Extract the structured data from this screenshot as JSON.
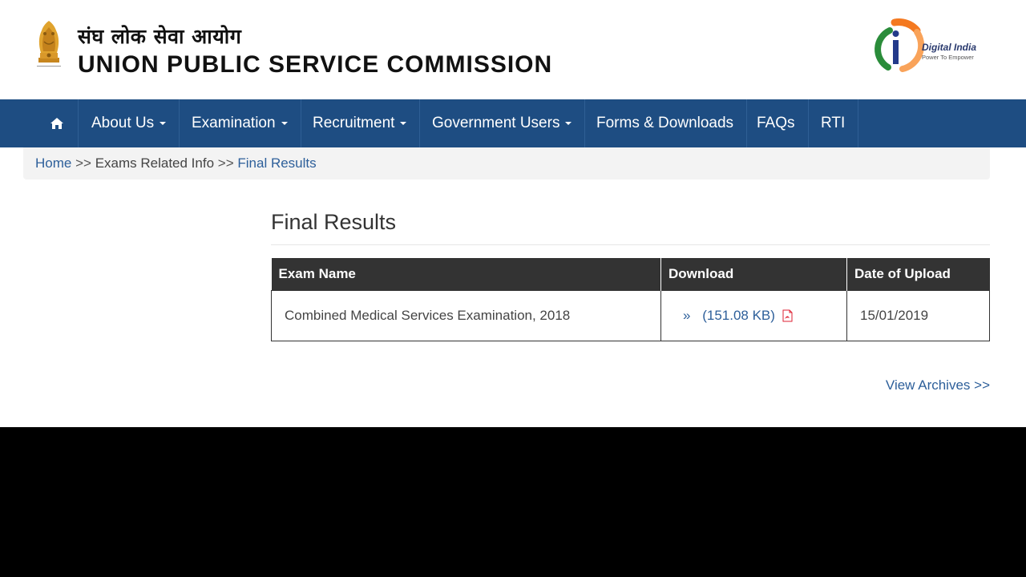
{
  "header": {
    "hindi_title": "संघ लोक सेवा आयोग",
    "english_title": "UNION PUBLIC SERVICE COMMISSION",
    "emblem_motto": "सत्यमेव जयते",
    "digital_india_title": "Digital India",
    "digital_india_tagline": "Power To Empower"
  },
  "nav": {
    "home_icon": "home-icon",
    "items": [
      {
        "label": "About Us",
        "dropdown": true
      },
      {
        "label": "Examination",
        "dropdown": true
      },
      {
        "label": "Recruitment",
        "dropdown": true
      },
      {
        "label": "Government Users",
        "dropdown": true
      },
      {
        "label": "Forms & Downloads",
        "dropdown": false
      },
      {
        "label": "FAQs",
        "dropdown": false
      },
      {
        "label": "RTI",
        "dropdown": false
      }
    ]
  },
  "breadcrumb": {
    "home": "Home",
    "separator": ">>",
    "middle": "Exams Related Info",
    "current": "Final Results"
  },
  "main": {
    "title": "Final Results",
    "table": {
      "headers": [
        "Exam Name",
        "Download",
        "Date of Upload"
      ],
      "rows": [
        {
          "exam_name": "Combined Medical Services Examination, 2018",
          "arrow": "»",
          "download_label": "(151.08 KB)",
          "date": "15/01/2019"
        }
      ]
    },
    "archives_link": "View Archives >>"
  },
  "colors": {
    "nav_bg": "#1e4d82",
    "link": "#2d5f9a",
    "table_header_bg": "#333333"
  }
}
